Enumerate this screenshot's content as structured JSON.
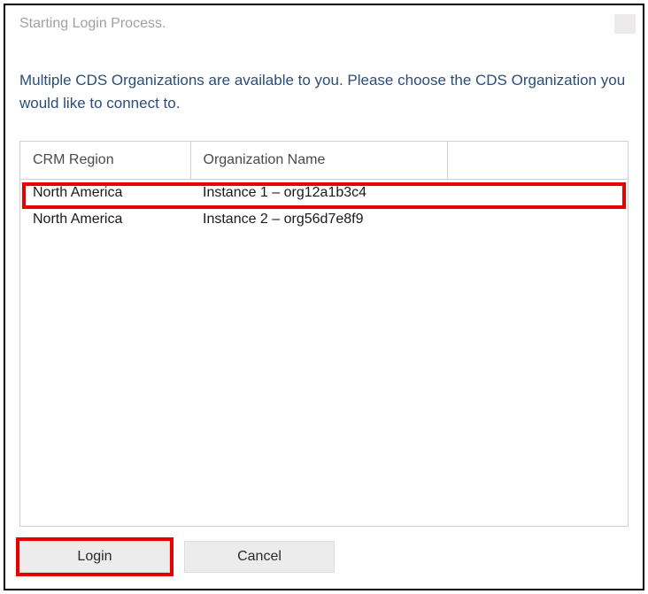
{
  "window": {
    "title": "Starting Login Process."
  },
  "instruction": "Multiple CDS Organizations are available to you. Please choose the CDS Organization you would like to connect to.",
  "table": {
    "headers": {
      "region": "CRM Region",
      "org": "Organization Name"
    },
    "rows": [
      {
        "region": "North America",
        "org": "Instance 1 – org12a1b3c4"
      },
      {
        "region": "North America",
        "org": "Instance 2 – org56d7e8f9"
      }
    ]
  },
  "buttons": {
    "login": "Login",
    "cancel": "Cancel"
  }
}
